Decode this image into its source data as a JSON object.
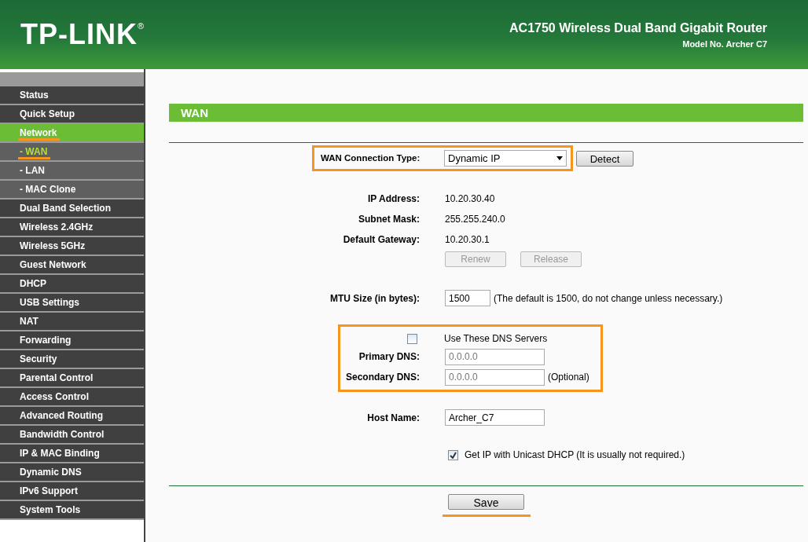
{
  "header": {
    "logo": "TP-LINK",
    "logo_mark": "®",
    "product": "AC1750 Wireless Dual Band Gigabit Router",
    "model": "Model No. Archer C7"
  },
  "sidebar": {
    "items": [
      {
        "label": "Status",
        "kind": "main",
        "selected": false,
        "highlighted": false
      },
      {
        "label": "Quick Setup",
        "kind": "main",
        "selected": false,
        "highlighted": false
      },
      {
        "label": "Network",
        "kind": "main",
        "selected": true,
        "highlighted": true
      },
      {
        "label": "- WAN",
        "kind": "sub",
        "selected": true,
        "highlighted": true
      },
      {
        "label": "- LAN",
        "kind": "sub",
        "selected": false,
        "highlighted": false
      },
      {
        "label": "- MAC Clone",
        "kind": "sub",
        "selected": false,
        "highlighted": false
      },
      {
        "label": "Dual Band Selection",
        "kind": "main",
        "selected": false,
        "highlighted": false
      },
      {
        "label": "Wireless 2.4GHz",
        "kind": "main",
        "selected": false,
        "highlighted": false
      },
      {
        "label": "Wireless 5GHz",
        "kind": "main",
        "selected": false,
        "highlighted": false
      },
      {
        "label": "Guest Network",
        "kind": "main",
        "selected": false,
        "highlighted": false
      },
      {
        "label": "DHCP",
        "kind": "main",
        "selected": false,
        "highlighted": false
      },
      {
        "label": "USB Settings",
        "kind": "main",
        "selected": false,
        "highlighted": false
      },
      {
        "label": "NAT",
        "kind": "main",
        "selected": false,
        "highlighted": false
      },
      {
        "label": "Forwarding",
        "kind": "main",
        "selected": false,
        "highlighted": false
      },
      {
        "label": "Security",
        "kind": "main",
        "selected": false,
        "highlighted": false
      },
      {
        "label": "Parental Control",
        "kind": "main",
        "selected": false,
        "highlighted": false
      },
      {
        "label": "Access Control",
        "kind": "main",
        "selected": false,
        "highlighted": false
      },
      {
        "label": "Advanced Routing",
        "kind": "main",
        "selected": false,
        "highlighted": false
      },
      {
        "label": "Bandwidth Control",
        "kind": "main",
        "selected": false,
        "highlighted": false
      },
      {
        "label": "IP & MAC Binding",
        "kind": "main",
        "selected": false,
        "highlighted": false
      },
      {
        "label": "Dynamic DNS",
        "kind": "main",
        "selected": false,
        "highlighted": false
      },
      {
        "label": "IPv6 Support",
        "kind": "main",
        "selected": false,
        "highlighted": false
      },
      {
        "label": "System Tools",
        "kind": "main",
        "selected": false,
        "highlighted": false
      }
    ]
  },
  "section_title": "WAN",
  "connection_type": {
    "label": "WAN Connection Type:",
    "value": "Dynamic IP",
    "button": "Detect",
    "highlighted": true
  },
  "info": [
    {
      "label": "IP Address:",
      "value": "10.20.30.40"
    },
    {
      "label": "Subnet Mask:",
      "value": "255.255.240.0"
    },
    {
      "label": "Default Gateway:",
      "value": "10.20.30.1"
    }
  ],
  "lease_buttons": [
    {
      "label": "Renew",
      "disabled": true
    },
    {
      "label": "Release",
      "disabled": true
    }
  ],
  "mtu": {
    "label": "MTU Size (in bytes):",
    "value": "1500",
    "note": "(The default is 1500, do not change unless necessary.)"
  },
  "dns": {
    "highlighted": true,
    "checkbox": {
      "label": "Use These DNS Servers",
      "checked": false
    },
    "primary": {
      "label": "Primary DNS:",
      "placeholder": "0.0.0.0"
    },
    "secondary": {
      "label": "Secondary DNS:",
      "placeholder": "0.0.0.0",
      "note": "(Optional)"
    }
  },
  "host_name": {
    "label": "Host Name:",
    "value": "Archer_C7"
  },
  "unicast": {
    "label": "Get IP with Unicast DHCP (It is usually not required.)",
    "checked": true
  },
  "save": {
    "label": "Save",
    "highlighted": true
  }
}
